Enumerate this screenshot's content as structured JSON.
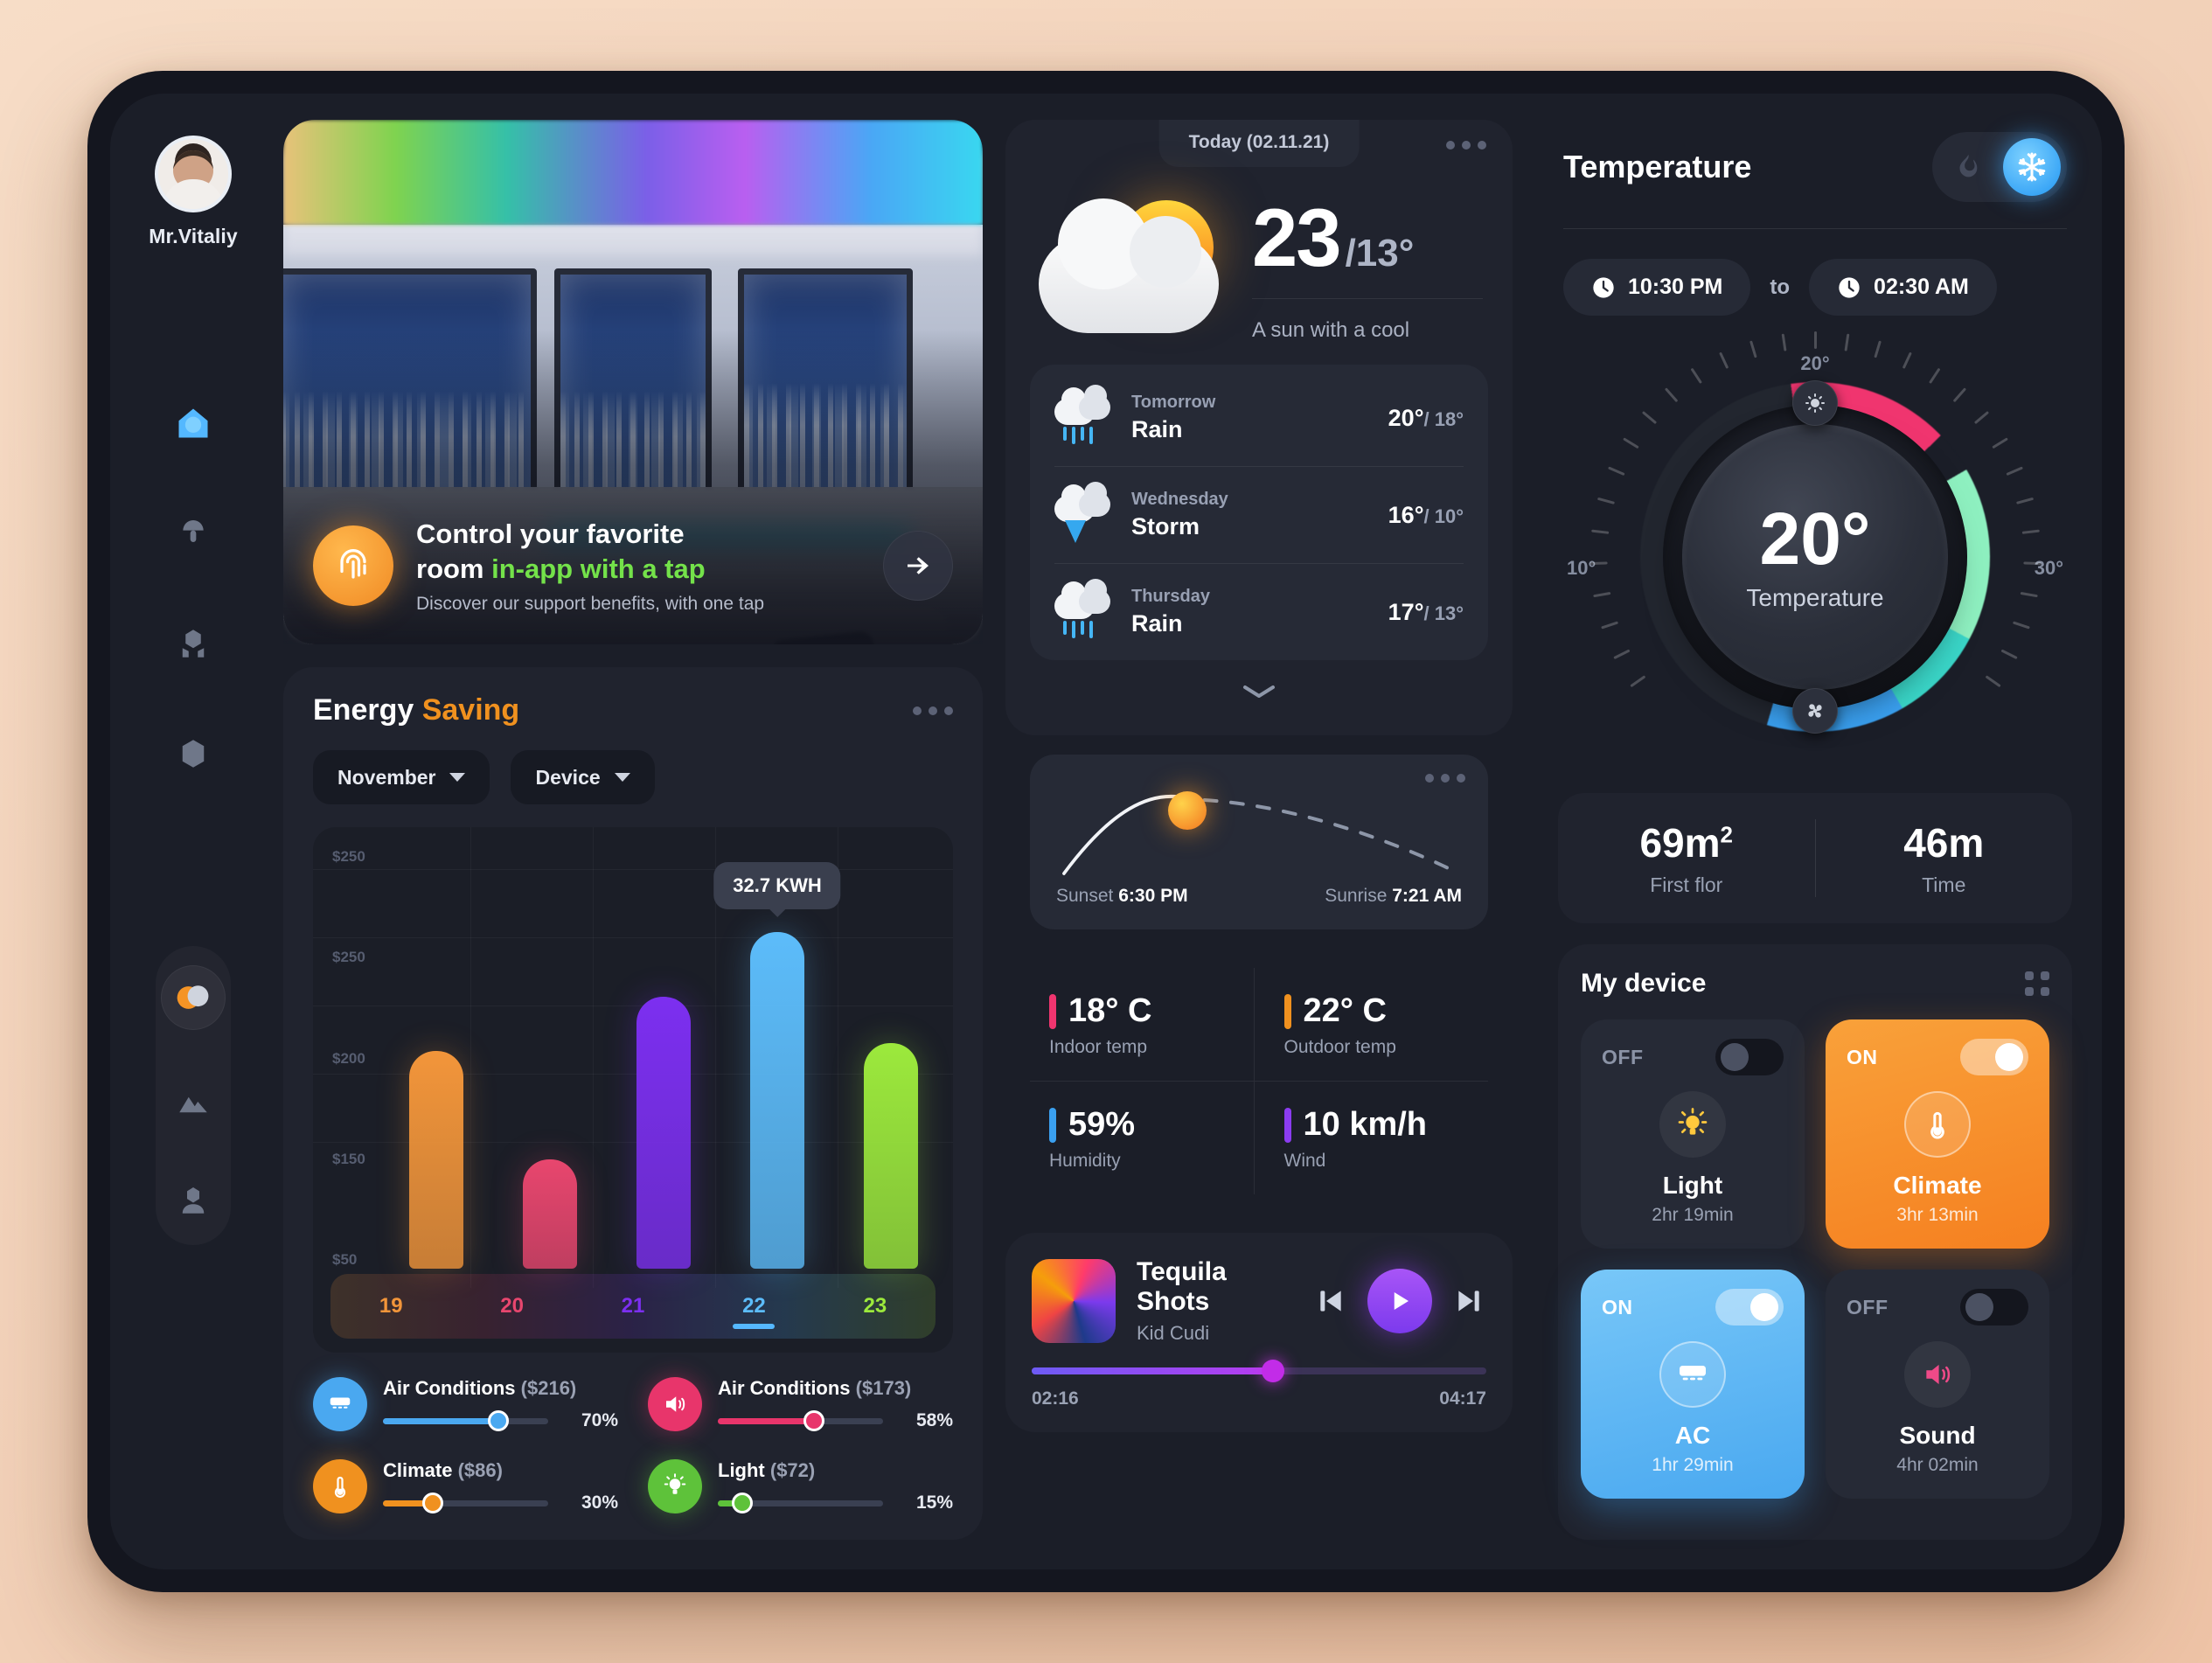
{
  "user": {
    "name": "Mr.Vitaliy",
    "avatar_icon": "user-avatar"
  },
  "sidebar": {
    "top_items": [
      {
        "icon": "home-icon",
        "active": true
      },
      {
        "icon": "lamp-icon",
        "active": false
      },
      {
        "icon": "devices-icon",
        "active": false
      },
      {
        "icon": "cube-icon",
        "active": false
      }
    ],
    "bottom_items": [
      {
        "icon": "brightness-icon",
        "active": true
      },
      {
        "icon": "mountain-icon",
        "active": false
      },
      {
        "icon": "profile-icon",
        "active": false
      }
    ]
  },
  "hero": {
    "title_plain": "Control your favorite room ",
    "title_part1": "Control your favorite",
    "title_part2": "room ",
    "title_highlight": "in-app with a tap",
    "subtitle": "Discover our support benefits, with one tap",
    "fingerprint_icon": "fingerprint-icon",
    "arrow_icon": "arrow-right-icon",
    "highlight_color": "#74e24a"
  },
  "energy": {
    "title_main": "Energy",
    "title_accent": "Saving",
    "accent_color": "#f0911f",
    "menu_icon": "more-dots-icon",
    "filters": [
      {
        "label": "November",
        "icon": "chevron-down-icon"
      },
      {
        "label": "Device",
        "icon": "chevron-down-icon"
      }
    ],
    "devices": [
      {
        "name": "Air Conditions",
        "cost": "($216)",
        "percent": "70%",
        "value": 70,
        "color": "#4aa8f0",
        "icon": "ac-icon"
      },
      {
        "name": "Air Conditions",
        "cost": "($173)",
        "percent": "58%",
        "value": 58,
        "color": "#e8356b",
        "icon": "speaker-icon"
      },
      {
        "name": "Climate",
        "cost": "($86)",
        "percent": "30%",
        "value": 30,
        "color": "#f0911f",
        "icon": "thermometer-icon"
      },
      {
        "name": "Light",
        "cost": "($72)",
        "percent": "15%",
        "value": 15,
        "color": "#5ec23a",
        "icon": "bulb-icon"
      }
    ]
  },
  "chart_data": {
    "type": "bar",
    "title": "Energy Saving",
    "categories": [
      "19",
      "20",
      "21",
      "22",
      "23"
    ],
    "values": [
      150,
      75,
      187,
      232,
      155
    ],
    "bar_colors": [
      "#f2953a",
      "#e8466e",
      "#7c2ff0",
      "#5cbcfa",
      "#9ce93c"
    ],
    "ytick_labels": [
      "$250",
      "$250",
      "$200",
      "$150",
      "$50"
    ],
    "ylim": [
      0,
      280
    ],
    "xlabel": "",
    "ylabel": "",
    "grid": true,
    "legend": "none",
    "highlight_index": 3,
    "annotation": "32.7 KWH"
  },
  "weather": {
    "today_label": "Today (02.11.21)",
    "menu_icon": "more-dots-icon",
    "icon": "sun-cloud-icon",
    "temp_high": "23",
    "temp_low": "/13°",
    "description": "A sun with a cool",
    "forecast": [
      {
        "day": "Tomorrow",
        "condition": "Rain",
        "high": "20°",
        "low": "/ 18°",
        "icon": "rain-icon"
      },
      {
        "day": "Wednesday",
        "condition": "Storm",
        "high": "16°",
        "low": "/ 10°",
        "icon": "storm-icon"
      },
      {
        "day": "Thursday",
        "condition": "Rain",
        "high": "17°",
        "low": "/ 13°",
        "icon": "rain-icon"
      }
    ],
    "expand_icon": "chevron-down-icon"
  },
  "sun": {
    "menu_icon": "more-dots-icon",
    "sunset_label": "Sunset",
    "sunset_time": "6:30 PM",
    "sunrise_label": "Sunrise",
    "sunrise_time": "7:21 AM",
    "sun_icon": "sun-icon"
  },
  "stats": [
    {
      "value": "18° C",
      "label": "Indoor temp",
      "color": "#f0356f"
    },
    {
      "value": "22° C",
      "label": "Outdoor temp",
      "color": "#f0911f"
    },
    {
      "value": "59%",
      "label": "Humidity",
      "color": "#3aa0f0"
    },
    {
      "value": "10 km/h",
      "label": "Wind",
      "color": "#8b3cf0"
    }
  ],
  "player": {
    "title": "Tequila Shots",
    "artist": "Kid Cudi",
    "elapsed": "02:16",
    "duration": "04:17",
    "progress": 53,
    "prev_icon": "skip-back-icon",
    "play_icon": "play-icon",
    "next_icon": "skip-forward-icon",
    "cover_icon": "album-art"
  },
  "temperature": {
    "title": "Temperature",
    "mode_heat_icon": "flame-icon",
    "mode_cool_icon": "snowflake-icon",
    "active_mode": "cool",
    "time_from": "10:30 PM",
    "time_to_label": "to",
    "time_to": "02:30 AM",
    "clock_icon": "clock-icon",
    "dial": {
      "value": "20°",
      "caption": "Temperature",
      "tick_top": "20°",
      "tick_left": "10°",
      "tick_right": "30°",
      "handle_top_icon": "brightness-icon",
      "handle_bottom_icon": "fan-icon"
    },
    "metrics": [
      {
        "value": "69m",
        "sup": "2",
        "label": "First flor"
      },
      {
        "value": "46m",
        "sup": "",
        "label": "Time"
      }
    ]
  },
  "my_device": {
    "title": "My device",
    "grip_icon": "grip-icon",
    "cards": [
      {
        "state": "OFF",
        "on": false,
        "name": "Light",
        "time": "2hr 19min",
        "icon": "bulb-icon",
        "theme": "off"
      },
      {
        "state": "ON",
        "on": true,
        "name": "Climate",
        "time": "3hr 13min",
        "icon": "thermometer-icon",
        "theme": "climate"
      },
      {
        "state": "ON",
        "on": true,
        "name": "AC",
        "time": "1hr 29min",
        "icon": "ac-icon",
        "theme": "ac"
      },
      {
        "state": "OFF",
        "on": false,
        "name": "Sound",
        "time": "4hr 02min",
        "icon": "speaker-icon",
        "theme": "off"
      }
    ]
  }
}
